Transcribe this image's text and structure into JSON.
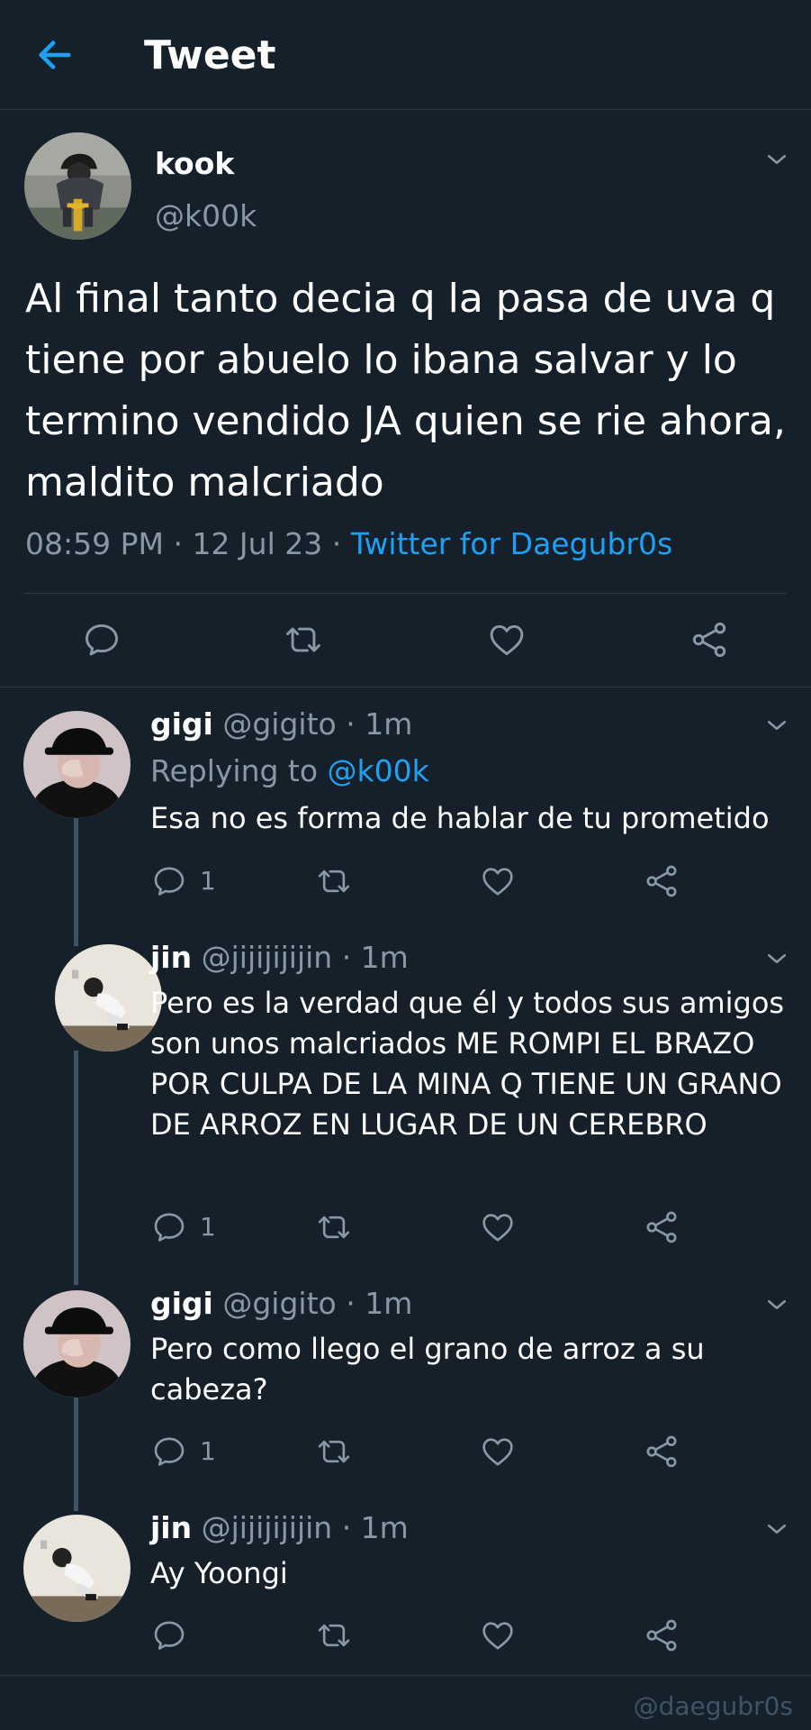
{
  "header": {
    "title": "Tweet",
    "back_icon": "arrow-left-icon"
  },
  "colors": {
    "background": "#15202b",
    "accent": "#1da1f2",
    "secondary_text": "#8899a6",
    "border": "#2c3a47",
    "thread_line": "#3d5466"
  },
  "main_tweet": {
    "name": "kook",
    "handle": "@k00k",
    "text": "Al final tanto decia q la pasa de uva q tiene por abuelo lo ibana salvar y lo termino vendido JA quien se rie ahora, maldito malcriado",
    "time": "08:59 PM",
    "sep1": " · ",
    "date": "12 Jul 23",
    "sep2": " · ",
    "source": "Twitter for Daegubr0s",
    "actions": [
      "reply-icon",
      "retweet-icon",
      "like-icon",
      "share-icon"
    ]
  },
  "replies": [
    {
      "name": "gigi",
      "handle_time": " @gigito · 1m",
      "replying_label": "Replying to ",
      "replying_to": "@k00k",
      "text": "Esa no es forma de hablar de tu prometido",
      "reply_count": "1"
    },
    {
      "name": "jin",
      "handle_time": " @jijijijijin · 1m",
      "text": "Pero es la verdad que él y todos sus amigos son unos malcriados ME ROMPI EL BRAZO POR CULPA DE LA MINA Q TIENE UN GRANO DE ARROZ EN LUGAR DE UN CEREBRO",
      "reply_count": "1"
    },
    {
      "name": "gigi",
      "handle_time": " @gigito · 1m",
      "text": "Pero como llego el grano de arroz a su cabeza?",
      "reply_count": "1"
    },
    {
      "name": "jin",
      "handle_time": " @jijijijijin · 1m",
      "text": "Ay Yoongi"
    }
  ],
  "watermark": "@daegubr0s"
}
